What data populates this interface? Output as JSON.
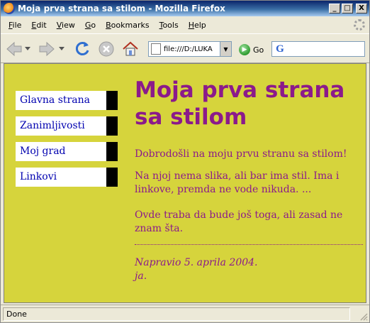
{
  "window": {
    "title": "Moja prva strana sa stilom - Mozilla Firefox",
    "minimize_glyph": "_",
    "maximize_glyph": "□",
    "close_glyph": "X"
  },
  "menubar": {
    "items": [
      {
        "ul": "F",
        "rest": "ile"
      },
      {
        "ul": "E",
        "rest": "dit"
      },
      {
        "ul": "V",
        "rest": "iew"
      },
      {
        "ul": "G",
        "rest": "o"
      },
      {
        "ul": "B",
        "rest": "ookmarks"
      },
      {
        "ul": "T",
        "rest": "ools"
      },
      {
        "ul": "H",
        "rest": "elp"
      }
    ]
  },
  "toolbar": {
    "address": "file:///D:/LUKA",
    "go_label": "Go",
    "search_value": ""
  },
  "page": {
    "nav": [
      "Glavna strana",
      "Zanimljivosti",
      "Moj grad",
      "Linkovi"
    ],
    "heading": "Moja prva strana sa stilom",
    "paragraphs": [
      "Dobrodošli na moju prvu stranu sa stilom!",
      "Na njoj nema slika, ali bar ima stil. Ima i linkove, premda ne vode nikuda. ...",
      "Ovde traba da bude još toga, ali zasad ne znam šta."
    ],
    "signature_line1": "Napravio 5. aprila 2004.",
    "signature_line2": "ja."
  },
  "status": {
    "text": "Done"
  },
  "colors": {
    "page_background": "#d6d43c",
    "text_purple": "#8b1a8b",
    "link_blue": "#0000b0",
    "nav_bar_black": "#000000"
  }
}
